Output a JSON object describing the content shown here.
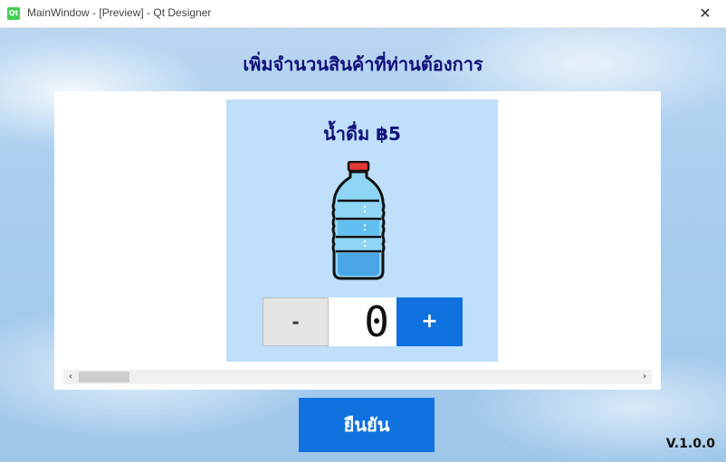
{
  "window": {
    "title": "MainWindow - [Preview] - Qt Designer",
    "app_icon": "qt-icon",
    "app_icon_text": "Qt",
    "close_glyph": "✕"
  },
  "header": {
    "title": "เพิ่มจำนวนสินค้าที่ท่านต้องการ"
  },
  "product": {
    "name_price": "น้ำดื่ม  ฿5",
    "image_icon": "water-bottle-icon",
    "quantity": "0",
    "minus_label": "-",
    "plus_label": "+"
  },
  "scrollbar": {
    "left_arrow": "‹",
    "right_arrow": "›"
  },
  "actions": {
    "confirm_label": "ยืนยัน"
  },
  "footer": {
    "version": "V.1.0.0"
  },
  "colors": {
    "accent": "#0f72de",
    "title_text": "#10107a",
    "card_bg": "#bfdffb"
  }
}
